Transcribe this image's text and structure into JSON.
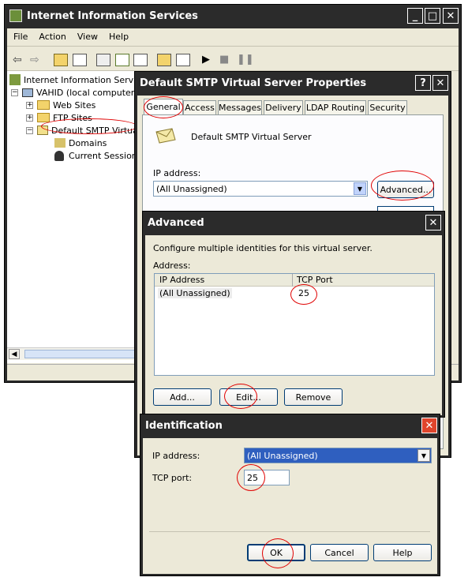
{
  "iis": {
    "title": "Internet Information Services",
    "menu": [
      "File",
      "Action",
      "View",
      "Help"
    ],
    "tree": {
      "root": "Internet Information Services",
      "computer": "VAHID (local computer)",
      "web_sites": "Web Sites",
      "ftp_sites": "FTP Sites",
      "smtp": "Default SMTP Virtual",
      "domains": "Domains",
      "sessions": "Current Sessions"
    }
  },
  "props": {
    "title": "Default SMTP Virtual Server Properties",
    "help": "?",
    "close": "✕",
    "tabs": [
      "General",
      "Access",
      "Messages",
      "Delivery",
      "LDAP Routing",
      "Security"
    ],
    "server_name": "Default SMTP Virtual Server",
    "ip_label": "IP address:",
    "ip_value": "(All Unassigned)",
    "advanced_button": "Advanced..."
  },
  "advanced": {
    "title": "Advanced",
    "description": "Configure multiple identities for this virtual server.",
    "address_label": "Address:",
    "columns": [
      "IP Address",
      "TCP Port"
    ],
    "rows": [
      [
        "(All Unassigned)",
        "25"
      ]
    ],
    "add_button": "Add...",
    "edit_button": "Edit...",
    "remove_button": "Remove"
  },
  "ident": {
    "title": "Identification",
    "ip_label": "IP address:",
    "ip_value": "(All Unassigned)",
    "port_label": "TCP port:",
    "port_value": "25",
    "ok_button": "OK",
    "cancel_button": "Cancel",
    "help_button": "Help"
  }
}
